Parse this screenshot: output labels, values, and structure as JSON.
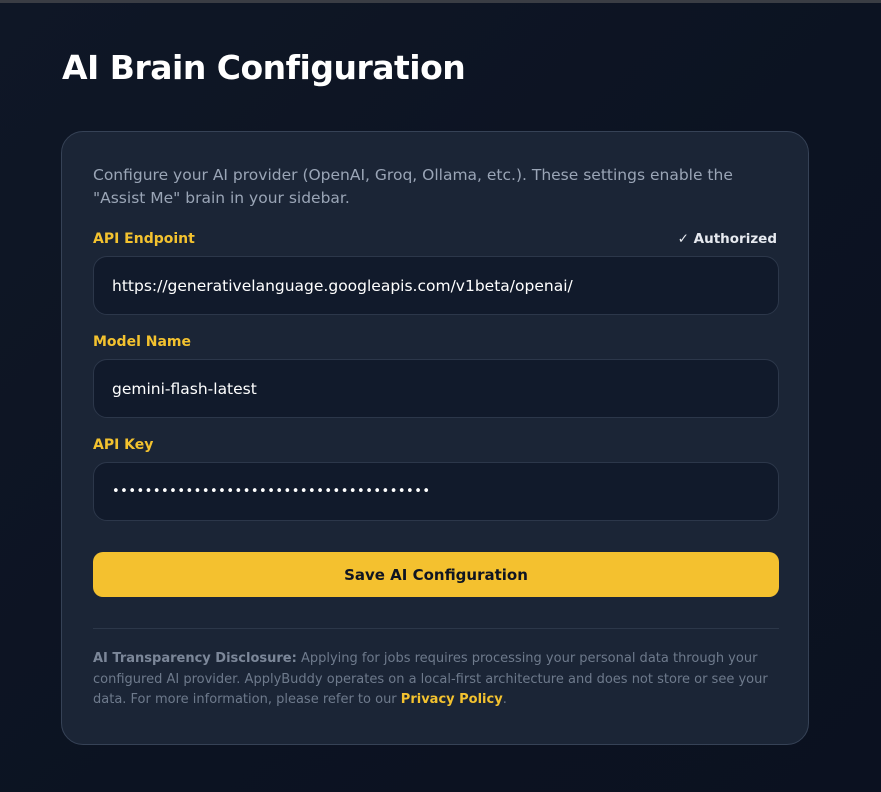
{
  "page": {
    "title": "AI Brain Configuration"
  },
  "card": {
    "intro": "Configure your AI provider (OpenAI, Groq, Ollama, etc.). These settings enable the \"Assist Me\" brain in your sidebar."
  },
  "fields": {
    "endpoint": {
      "label": "API Endpoint",
      "status": "✓ Authorized",
      "value": "https://generativelanguage.googleapis.com/v1beta/openai/"
    },
    "model": {
      "label": "Model Name",
      "value": "gemini-flash-latest"
    },
    "api_key": {
      "label": "API Key",
      "value": "•••••••••••••••••••••••••••••••••••••••"
    }
  },
  "actions": {
    "save_label": "Save AI Configuration"
  },
  "disclosure": {
    "title": "AI Transparency Disclosure:",
    "body": " Applying for jobs requires processing your personal data through your configured AI provider. ApplyBuddy operates on a local-first architecture and does not store or see your data. For more information, please refer to our ",
    "link": "Privacy Policy",
    "end": "."
  },
  "colors": {
    "accent": "#f3c22f",
    "background": "#0f1726",
    "card": "#1b2536",
    "input": "#111a2b"
  }
}
